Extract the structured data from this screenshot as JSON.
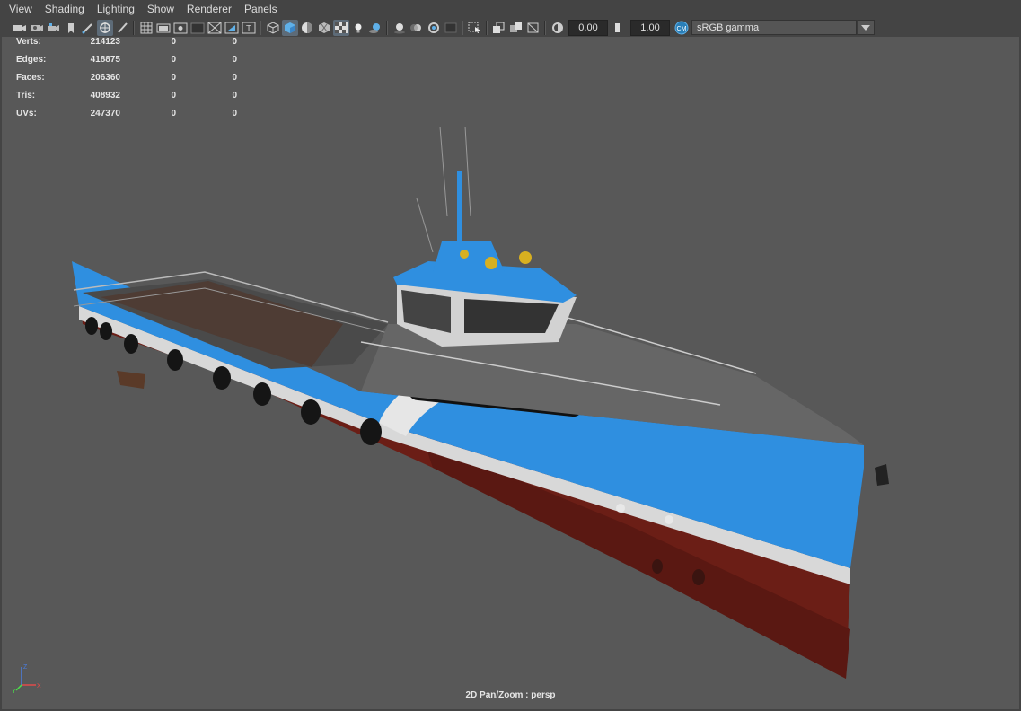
{
  "menu": [
    "View",
    "Shading",
    "Lighting",
    "Show",
    "Renderer",
    "Panels"
  ],
  "toolbar": {
    "exposure_value": "0.00",
    "gamma_value": "1.00",
    "color_space": "sRGB gamma",
    "icons": [
      "camera-select-icon",
      "camera-attributes-icon",
      "bookmarks-icon",
      "image-plane-icon",
      "grease-pencil-icon",
      "2d-pan-zoom-icon",
      "grid-icon",
      "film-gate-icon",
      "resolution-gate-icon",
      "gate-mask-icon",
      "field-chart-icon",
      "safe-action-icon",
      "safe-title-icon",
      "wireframe-icon",
      "smooth-shade-icon",
      "default-material-icon",
      "textured-icon",
      "use-all-lights-icon",
      "shadows-icon",
      "ambient-occlusion-icon",
      "motion-blur-icon",
      "anti-aliasing-icon",
      "isolate-select-icon",
      "xray-icon",
      "xray-joints-icon",
      "xray-components-icon",
      "exposure-icon",
      "gamma-icon",
      "view-transform-icon"
    ]
  },
  "hud": {
    "rows": [
      {
        "label": "Verts:",
        "values": [
          "214123",
          "0",
          "0"
        ]
      },
      {
        "label": "Edges:",
        "values": [
          "418875",
          "0",
          "0"
        ]
      },
      {
        "label": "Faces:",
        "values": [
          "206360",
          "0",
          "0"
        ]
      },
      {
        "label": "Tris:",
        "values": [
          "408932",
          "0",
          "0"
        ]
      },
      {
        "label": "UVs:",
        "values": [
          "247370",
          "0",
          "0"
        ]
      }
    ]
  },
  "camera_label": "2D Pan/Zoom : persp",
  "axis_labels": {
    "x": "X",
    "y": "Y",
    "z": "Z"
  },
  "colors": {
    "viewport_bg": "#585858",
    "hull_blue": "#2f8fe0",
    "hull_red": "#5a1a14",
    "deck_white": "#d8d8d8"
  }
}
